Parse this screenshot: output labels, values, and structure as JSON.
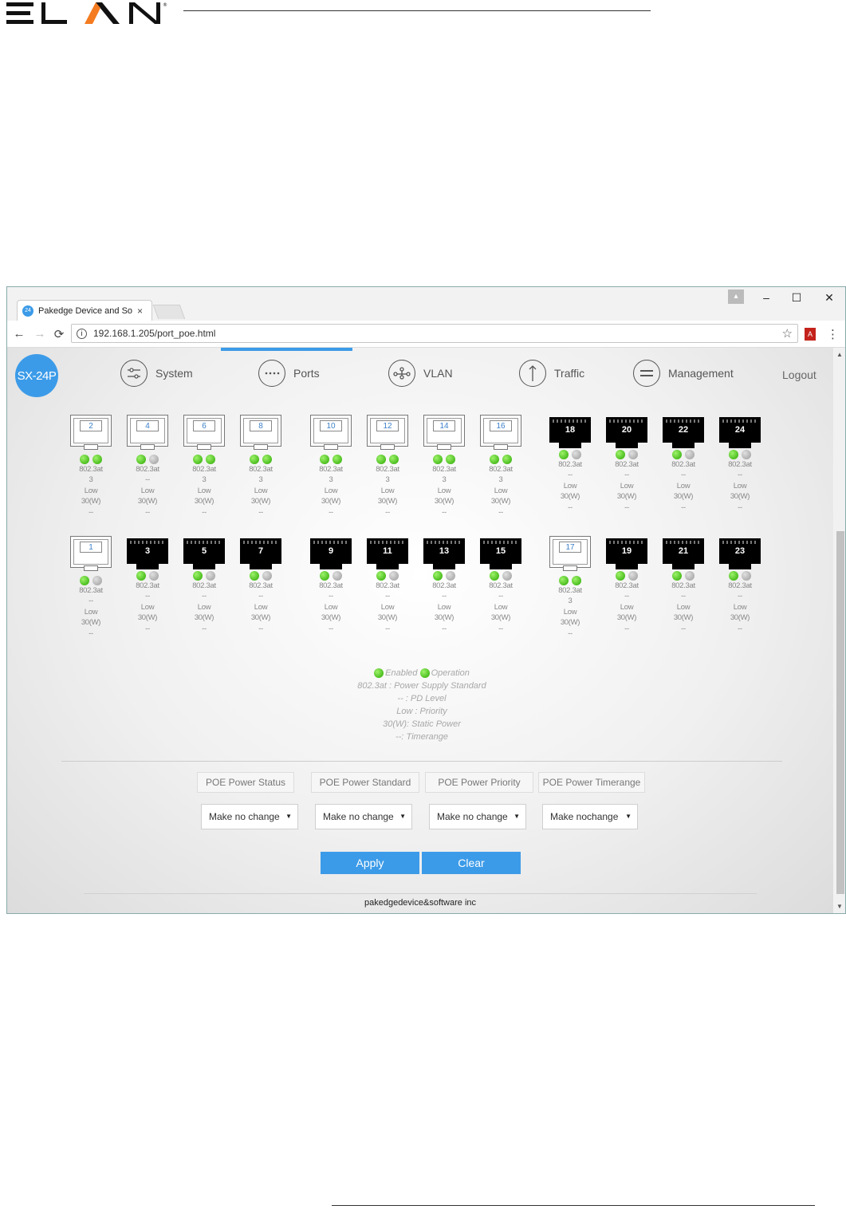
{
  "logo": "ELAN",
  "browser": {
    "tab_title": "Pakedge Device and Soft",
    "tab_favicon": "24",
    "close": "×",
    "url": "192.168.1.205/port_poe.html",
    "win_min": "–",
    "win_max": "☐",
    "win_close": "✕",
    "icons": {
      "back": "←",
      "forward": "→",
      "reload": "⟳",
      "info": "i",
      "star": "☆",
      "menu": "⋮",
      "user": "👤",
      "pdf": "A"
    }
  },
  "page": {
    "model": "SX-24P",
    "nav": [
      "System",
      "Ports",
      "VLAN",
      "Traffic",
      "Management"
    ],
    "logout": "Logout"
  },
  "ports_top": [
    {
      "num": "2",
      "linked": true,
      "enabled": true,
      "operation": true,
      "standard": "802.3at",
      "pd": "3",
      "priority": "Low",
      "power": "30(W)",
      "timerange": "--"
    },
    {
      "num": "4",
      "linked": true,
      "enabled": true,
      "operation": false,
      "standard": "802.3at",
      "pd": "--",
      "priority": "Low",
      "power": "30(W)",
      "timerange": "--"
    },
    {
      "num": "6",
      "linked": true,
      "enabled": true,
      "operation": true,
      "standard": "802.3at",
      "pd": "3",
      "priority": "Low",
      "power": "30(W)",
      "timerange": "--"
    },
    {
      "num": "8",
      "linked": true,
      "enabled": true,
      "operation": true,
      "standard": "802.3at",
      "pd": "3",
      "priority": "Low",
      "power": "30(W)",
      "timerange": "--"
    },
    {
      "num": "10",
      "linked": true,
      "enabled": true,
      "operation": true,
      "standard": "802.3at",
      "pd": "3",
      "priority": "Low",
      "power": "30(W)",
      "timerange": "--"
    },
    {
      "num": "12",
      "linked": true,
      "enabled": true,
      "operation": true,
      "standard": "802.3at",
      "pd": "3",
      "priority": "Low",
      "power": "30(W)",
      "timerange": "--"
    },
    {
      "num": "14",
      "linked": true,
      "enabled": true,
      "operation": true,
      "standard": "802.3at",
      "pd": "3",
      "priority": "Low",
      "power": "30(W)",
      "timerange": "--"
    },
    {
      "num": "16",
      "linked": true,
      "enabled": true,
      "operation": true,
      "standard": "802.3at",
      "pd": "3",
      "priority": "Low",
      "power": "30(W)",
      "timerange": "--"
    },
    {
      "num": "18",
      "linked": false,
      "enabled": true,
      "operation": false,
      "standard": "802.3at",
      "pd": "--",
      "priority": "Low",
      "power": "30(W)",
      "timerange": "--"
    },
    {
      "num": "20",
      "linked": false,
      "enabled": true,
      "operation": false,
      "standard": "802.3at",
      "pd": "--",
      "priority": "Low",
      "power": "30(W)",
      "timerange": "--"
    },
    {
      "num": "22",
      "linked": false,
      "enabled": true,
      "operation": false,
      "standard": "802.3at",
      "pd": "--",
      "priority": "Low",
      "power": "30(W)",
      "timerange": "--"
    },
    {
      "num": "24",
      "linked": false,
      "enabled": true,
      "operation": false,
      "standard": "802.3at",
      "pd": "--",
      "priority": "Low",
      "power": "30(W)",
      "timerange": "--"
    }
  ],
  "ports_bottom": [
    {
      "num": "1",
      "linked": true,
      "enabled": true,
      "operation": false,
      "standard": "802.3at",
      "pd": "--",
      "priority": "Low",
      "power": "30(W)",
      "timerange": "--"
    },
    {
      "num": "3",
      "linked": false,
      "enabled": true,
      "operation": false,
      "standard": "802.3at",
      "pd": "--",
      "priority": "Low",
      "power": "30(W)",
      "timerange": "--"
    },
    {
      "num": "5",
      "linked": false,
      "enabled": true,
      "operation": false,
      "standard": "802.3at",
      "pd": "--",
      "priority": "Low",
      "power": "30(W)",
      "timerange": "--"
    },
    {
      "num": "7",
      "linked": false,
      "enabled": true,
      "operation": false,
      "standard": "802.3at",
      "pd": "--",
      "priority": "Low",
      "power": "30(W)",
      "timerange": "--"
    },
    {
      "num": "9",
      "linked": false,
      "enabled": true,
      "operation": false,
      "standard": "802.3at",
      "pd": "--",
      "priority": "Low",
      "power": "30(W)",
      "timerange": "--"
    },
    {
      "num": "11",
      "linked": false,
      "enabled": true,
      "operation": false,
      "standard": "802.3at",
      "pd": "--",
      "priority": "Low",
      "power": "30(W)",
      "timerange": "--"
    },
    {
      "num": "13",
      "linked": false,
      "enabled": true,
      "operation": false,
      "standard": "802.3at",
      "pd": "--",
      "priority": "Low",
      "power": "30(W)",
      "timerange": "--"
    },
    {
      "num": "15",
      "linked": false,
      "enabled": true,
      "operation": false,
      "standard": "802.3at",
      "pd": "--",
      "priority": "Low",
      "power": "30(W)",
      "timerange": "--"
    },
    {
      "num": "17",
      "linked": true,
      "enabled": true,
      "operation": true,
      "standard": "802.3at",
      "pd": "3",
      "priority": "Low",
      "power": "30(W)",
      "timerange": "--"
    },
    {
      "num": "19",
      "linked": false,
      "enabled": true,
      "operation": false,
      "standard": "802.3at",
      "pd": "--",
      "priority": "Low",
      "power": "30(W)",
      "timerange": "--"
    },
    {
      "num": "21",
      "linked": false,
      "enabled": true,
      "operation": false,
      "standard": "802.3at",
      "pd": "--",
      "priority": "Low",
      "power": "30(W)",
      "timerange": "--"
    },
    {
      "num": "23",
      "linked": false,
      "enabled": true,
      "operation": false,
      "standard": "802.3at",
      "pd": "--",
      "priority": "Low",
      "power": "30(W)",
      "timerange": "--"
    }
  ],
  "legend": {
    "enabled": "Enabled",
    "operation": "Operation",
    "standard": "802.3at : Power Supply Standard",
    "pd": "-- : PD Level",
    "priority": "Low : Priority",
    "power": "30(W): Static Power",
    "timerange": "--: Timerange"
  },
  "controls": {
    "headers": [
      "POE Power Status",
      "POE Power Standard",
      "POE Power Priority",
      "POE Power Timerange"
    ],
    "selects": [
      "Make no change",
      "Make no change",
      "Make no change",
      "Make nochange"
    ],
    "apply": "Apply",
    "clear": "Clear"
  },
  "footer": "pakedgedevice&software inc",
  "colors": {
    "accent": "#3c9be8",
    "led_on": "#2aa800",
    "led_off": "#9a9a9a"
  }
}
